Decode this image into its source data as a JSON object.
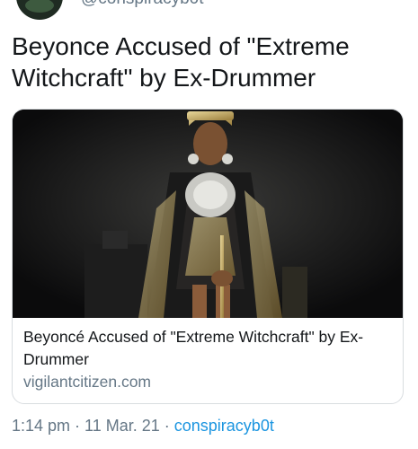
{
  "tweet": {
    "handle": "@conspiracyb0t",
    "text": "Beyonce Accused of \"Extreme Witchcraft\" by Ex-Drummer"
  },
  "link_card": {
    "image_alt": "performer in gold crown and jeweled costume on dark stage",
    "title": "Beyoncé Accused of \"Extreme Witchcraft\" by Ex-Drummer",
    "domain": "vigilantcitizen.com"
  },
  "meta": {
    "time": "1:14 pm",
    "date": "11 Mar. 21",
    "source": "conspiracyb0t",
    "separator": "·"
  },
  "colors": {
    "text": "#14171a",
    "muted": "#657786",
    "link": "#1b95e0",
    "border": "#d9dde0"
  }
}
